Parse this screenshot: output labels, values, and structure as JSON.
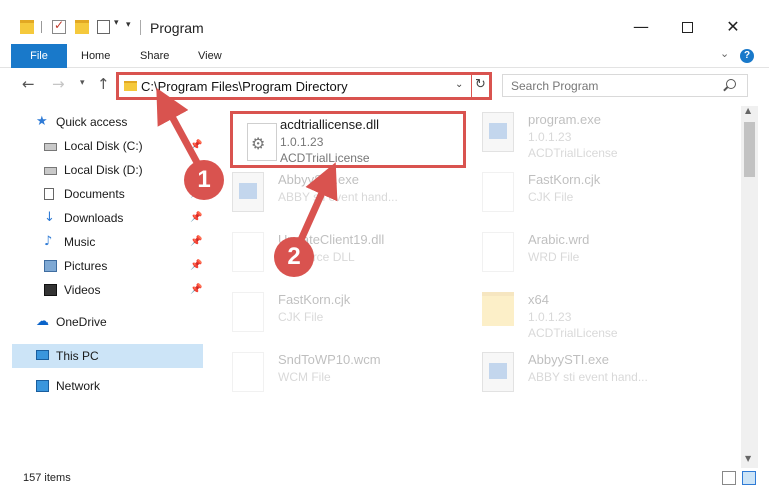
{
  "window": {
    "title": "Program",
    "minimize": "—",
    "close": "✕"
  },
  "quick_access_toolbar": {
    "dropdown": "▾",
    "customize": "▾"
  },
  "ribbon": {
    "tabs": [
      "File",
      "Home",
      "Share",
      "View"
    ],
    "expand": "⌄",
    "help": "?"
  },
  "nav": {
    "back": "←",
    "forward": "→",
    "recent": "▾",
    "up": "↑",
    "address": "C:\\Program Files\\Program Directory",
    "address_dropdown": "⌄",
    "refresh": "↻",
    "search_placeholder": "Search Program"
  },
  "sidebar": {
    "items": [
      {
        "label": "Quick access",
        "icon": "star-icon"
      },
      {
        "label": "Local Disk (C:)",
        "icon": "disk-icon",
        "pinned": true
      },
      {
        "label": "Local Disk (D:)",
        "icon": "disk-icon",
        "pinned": false
      },
      {
        "label": "Documents",
        "icon": "documents-icon",
        "pinned": true
      },
      {
        "label": "Downloads",
        "icon": "downloads-icon",
        "pinned": true
      },
      {
        "label": "Music",
        "icon": "music-icon",
        "pinned": true
      },
      {
        "label": "Pictures",
        "icon": "pictures-icon",
        "pinned": true
      },
      {
        "label": "Videos",
        "icon": "videos-icon",
        "pinned": true
      },
      {
        "label": "OneDrive",
        "icon": "onedrive-icon"
      },
      {
        "label": "This PC",
        "icon": "pc-icon",
        "selected": true
      },
      {
        "label": "Network",
        "icon": "network-icon"
      }
    ],
    "pin_glyph": "📌"
  },
  "files": [
    {
      "name": "acdtriallicense.dll",
      "line1": "1.0.1.23",
      "line2": "ACDTrialLicense",
      "icon": "gear-file-icon",
      "highlighted": true
    },
    {
      "name": "program.exe",
      "line1": "1.0.1.23",
      "line2": "ACDTrialLicense",
      "icon": "exe-icon"
    },
    {
      "name": "AbbyySTI.exe",
      "line1": "ABBY sti event hand...",
      "line2": "",
      "icon": "exe-icon"
    },
    {
      "name": "FastKorn.cjk",
      "line1": "CJK File",
      "line2": "",
      "icon": "file-icon"
    },
    {
      "name": "UpdateClient19.dll",
      "line1": "Resource DLL",
      "line2": "",
      "icon": "gear-file-icon"
    },
    {
      "name": "Arabic.wrd",
      "line1": "WRD File",
      "line2": "",
      "icon": "file-icon"
    },
    {
      "name": "FastKorn.cjk",
      "line1": "CJK File",
      "line2": "",
      "icon": "file-icon"
    },
    {
      "name": "x64",
      "line1": "1.0.1.23",
      "line2": "ACDTrialLicense",
      "icon": "folder-icon"
    },
    {
      "name": "SndToWP10.wcm",
      "line1": "WCM File",
      "line2": "",
      "icon": "file-icon"
    },
    {
      "name": "AbbyySTI.exe",
      "line1": "ABBY sti event hand...",
      "line2": "",
      "icon": "exe-icon"
    }
  ],
  "status": {
    "item_count": "157 items"
  },
  "scrollbar": {
    "up": "▲",
    "down": "▼"
  },
  "annotations": {
    "step1": "1",
    "step2": "2",
    "color": "#d9534f"
  },
  "colors": {
    "accent": "#1979ca",
    "selection": "#cce4f7",
    "highlight": "#d9534f"
  }
}
